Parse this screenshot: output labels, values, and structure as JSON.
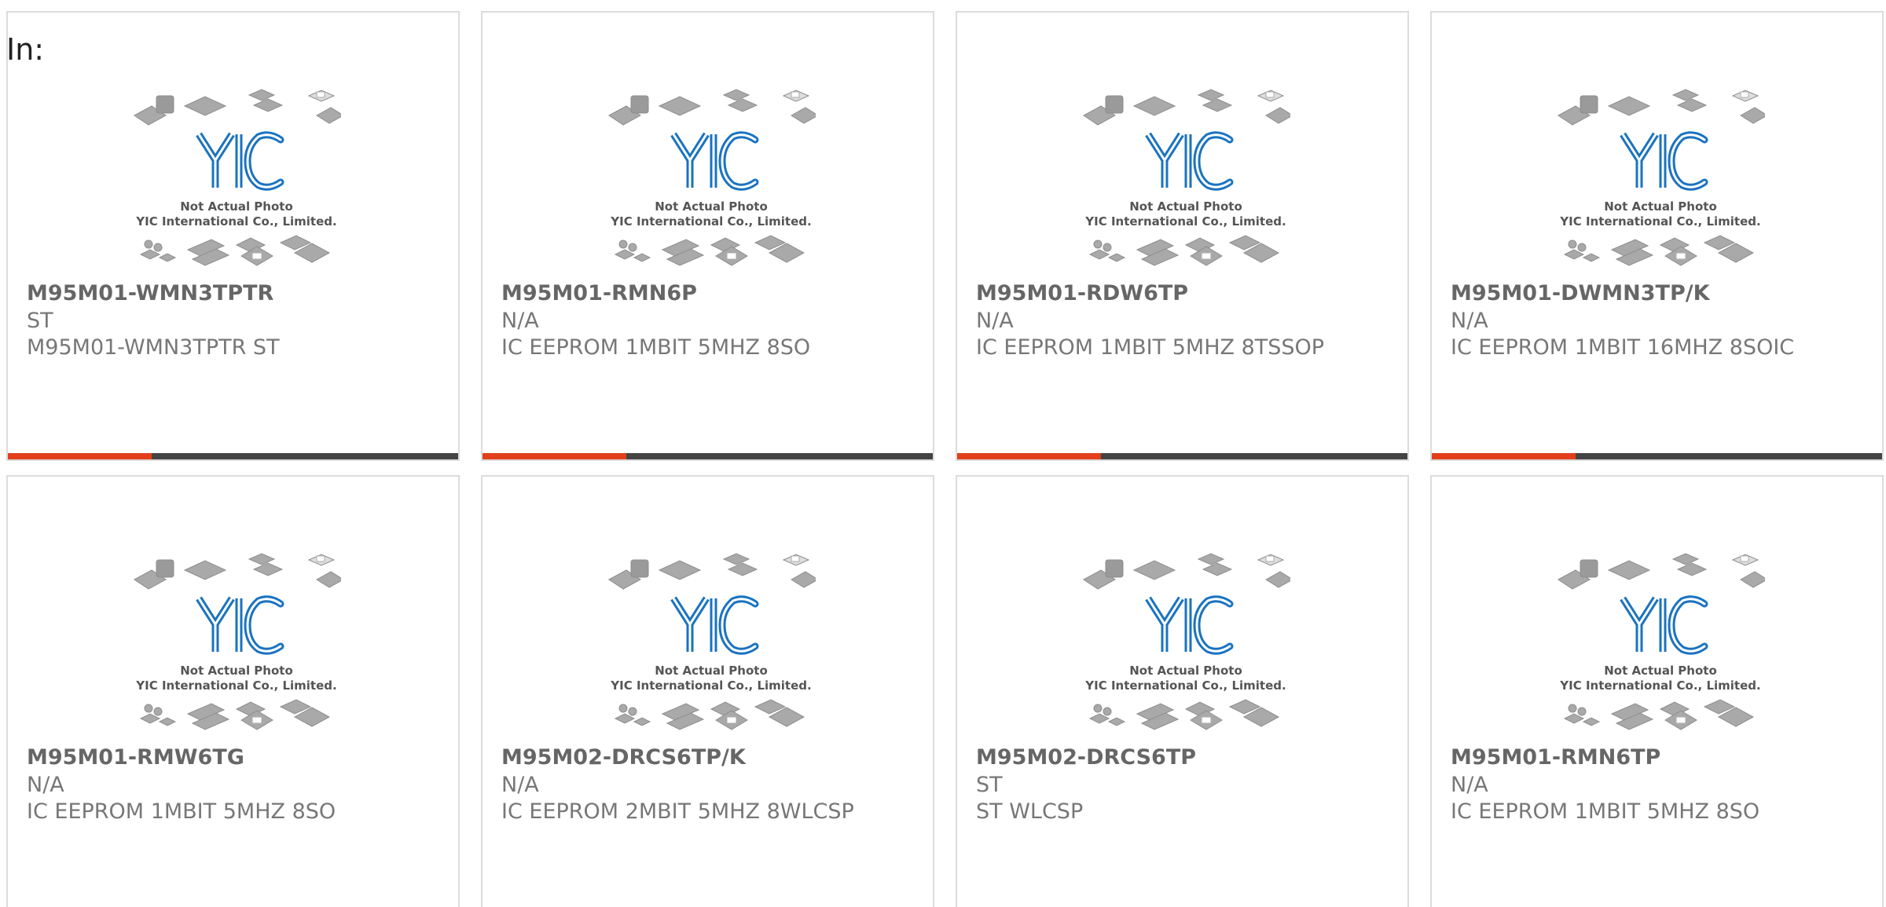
{
  "header": {
    "label": "In:"
  },
  "colors": {
    "accent": "#e2401c",
    "bar": "#444444",
    "logo": "#1a73c0"
  },
  "placeholder": {
    "line1": "Not Actual Photo",
    "line2": "YIC International Co., Limited."
  },
  "products": [
    {
      "part": "M95M01-WMN3TPTR",
      "brand": "ST",
      "desc": "M95M01-WMN3TPTR ST"
    },
    {
      "part": "M95M01-RMN6P",
      "brand": "N/A",
      "desc": "IC EEPROM 1MBIT 5MHZ 8SO"
    },
    {
      "part": "M95M01-RDW6TP",
      "brand": "N/A",
      "desc": "IC EEPROM 1MBIT 5MHZ 8TSSOP"
    },
    {
      "part": "M95M01-DWMN3TP/K",
      "brand": "N/A",
      "desc": "IC EEPROM 1MBIT 16MHZ 8SOIC"
    },
    {
      "part": "M95M01-RMW6TG",
      "brand": "N/A",
      "desc": "IC EEPROM 1MBIT 5MHZ 8SO"
    },
    {
      "part": "M95M02-DRCS6TP/K",
      "brand": "N/A",
      "desc": "IC EEPROM 2MBIT 5MHZ 8WLCSP"
    },
    {
      "part": "M95M02-DRCS6TP",
      "brand": "ST",
      "desc": "ST WLCSP"
    },
    {
      "part": "M95M01-RMN6TP",
      "brand": "N/A",
      "desc": "IC EEPROM 1MBIT 5MHZ 8SO"
    }
  ]
}
